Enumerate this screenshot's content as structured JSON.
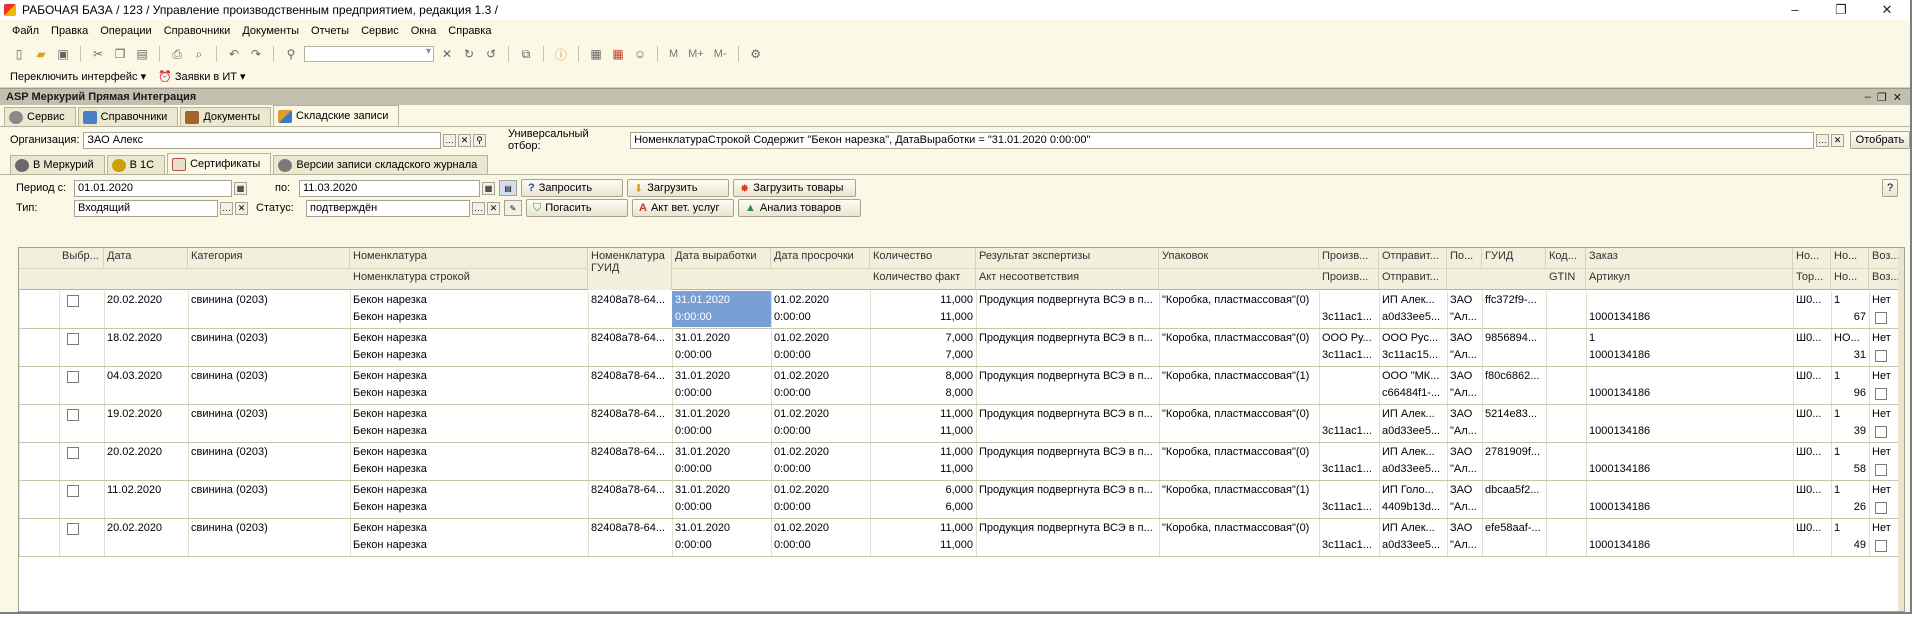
{
  "window": {
    "title": "РАБОЧАЯ БАЗА / 123 / Управление производственным предприятием, редакция 1.3 /",
    "controls": [
      "–",
      "❐",
      "✕"
    ]
  },
  "menu": [
    "Файл",
    "Правка",
    "Операции",
    "Справочники",
    "Документы",
    "Отчеты",
    "Сервис",
    "Окна",
    "Справка"
  ],
  "toolbar2": {
    "switch_interface": "Переключить интерфейс",
    "requests_it": "Заявки в ИТ",
    "m": "M",
    "mplus": "M+",
    "mminus": "M-"
  },
  "subwindow": {
    "title": "ASP Меркурий Прямая Интеграция",
    "tabs": [
      "Сервис",
      "Справочники",
      "Документы",
      "Складские записи"
    ]
  },
  "org": {
    "label": "Организация:",
    "value": "ЗАО  Алекс",
    "universal_filter_label": "Универсальный отбор:",
    "universal_filter_value": "НоменклатураСтрокой Содержит \"Бекон нарезка\", ДатаВыработки = \"31.01.2020 0:00:00\"",
    "select_button": "Отобрать"
  },
  "inner_tabs": [
    "В Меркурий",
    "В 1С",
    "Сертификаты",
    "Версии записи складского журнала"
  ],
  "filters": {
    "period_from_label": "Период с:",
    "period_from": "01.01.2020",
    "period_to_label": "по:",
    "period_to": "11.03.2020",
    "type_label": "Тип:",
    "type_value": "Входящий",
    "status_label": "Статус:",
    "status_value": "подтверждён",
    "btn_request": "Запросить",
    "btn_load": "Загрузить",
    "btn_load_goods": "Загрузить товары",
    "btn_repay": "Погасить",
    "btn_act": "Акт вет. услуг",
    "btn_analysis": "Анализ товаров",
    "help": "?"
  },
  "table": {
    "headers_top": [
      "Выбр...",
      "Дата",
      "Категория",
      "Номенклатура",
      "Номенклатура ГУИД",
      "Дата выработки",
      "Дата просрочки",
      "Количество",
      "Результат экспертизы",
      "Упаковок",
      "Произв...",
      "Отправит...",
      "По...",
      "ГУИД",
      "Код...",
      "Заказ",
      "Но...",
      "Но...",
      "Воз..."
    ],
    "headers_bottom": [
      "Номенклатура строкой",
      "Количество факт",
      "Акт несоответствия",
      "Произв...",
      "Отправит...",
      "GTIN",
      "Артикул",
      "Тор...",
      "Но...",
      "Воз..."
    ],
    "rows": [
      {
        "date": "20.02.2020",
        "category": "свинина (0203)",
        "nom": "Бекон нарезка",
        "nom_str": "Бекон нарезка",
        "guid_nom": "82408a78-64...",
        "prod_date": "31.01.2020",
        "prod_time": "0:00:00",
        "exp_date": "01.02.2020",
        "exp_time": "0:00:00",
        "qty": "11,000",
        "qty_fact": "11,000",
        "result": "Продукция подвергнута ВСЭ в п...",
        "pack": "\"Коробка, пластмассовая\"(0)",
        "prod2": "3c11ac1...",
        "sender": "ИП Алек...",
        "sender2": "a0d33ee5...",
        "po": "ЗАО",
        "po2": "\"Ал...",
        "guid": "ffc372f9-...",
        "order": "",
        "article": "1000134186",
        "n1": "Ш0...",
        "n2": "1",
        "n3": "67",
        "voz": "Нет",
        "selected": true
      },
      {
        "date": "18.02.2020",
        "category": "свинина (0203)",
        "nom": "Бекон нарезка",
        "nom_str": "Бекон нарезка",
        "guid_nom": "82408a78-64...",
        "prod_date": "31.01.2020",
        "prod_time": "0:00:00",
        "exp_date": "01.02.2020",
        "exp_time": "0:00:00",
        "qty": "7,000",
        "qty_fact": "7,000",
        "result": "Продукция подвергнута ВСЭ в п...",
        "pack": "\"Коробка, пластмассовая\"(0)",
        "prod1": "ООО Ру...",
        "prod2": "3c11ac1...",
        "sender": "ООО Рус...",
        "sender2": "3c11ac15...",
        "po": "ЗАО",
        "po2": "\"Ал...",
        "guid": "9856894...",
        "order": "1",
        "article": "1000134186",
        "n1": "Ш0...",
        "n2": "НО...",
        "n3": "31",
        "voz": "Нет"
      },
      {
        "date": "04.03.2020",
        "category": "свинина (0203)",
        "nom": "Бекон нарезка",
        "nom_str": "Бекон нарезка",
        "guid_nom": "82408a78-64...",
        "prod_date": "31.01.2020",
        "prod_time": "0:00:00",
        "exp_date": "01.02.2020",
        "exp_time": "0:00:00",
        "qty": "8,000",
        "qty_fact": "8,000",
        "result": "Продукция подвергнута ВСЭ в п...",
        "pack": "\"Коробка, пластмассовая\"(1)",
        "sender": "ООО \"МК...",
        "sender2": "c66484f1-...",
        "po": "ЗАО",
        "po2": "\"Ал...",
        "guid": "f80c6862...",
        "order": "",
        "article": "1000134186",
        "n1": "Ш0...",
        "n2": "1",
        "n3": "96",
        "voz": "Нет"
      },
      {
        "date": "19.02.2020",
        "category": "свинина (0203)",
        "nom": "Бекон нарезка",
        "nom_str": "Бекон нарезка",
        "guid_nom": "82408a78-64...",
        "prod_date": "31.01.2020",
        "prod_time": "0:00:00",
        "exp_date": "01.02.2020",
        "exp_time": "0:00:00",
        "qty": "11,000",
        "qty_fact": "11,000",
        "result": "Продукция подвергнута ВСЭ в п...",
        "pack": "\"Коробка, пластмассовая\"(0)",
        "prod2": "3c11ac1...",
        "sender": "ИП Алек...",
        "sender2": "a0d33ee5...",
        "po": "ЗАО",
        "po2": "\"Ал...",
        "guid": "5214e83...",
        "order": "",
        "article": "1000134186",
        "n1": "Ш0...",
        "n2": "1",
        "n3": "39",
        "voz": "Нет"
      },
      {
        "date": "20.02.2020",
        "category": "свинина (0203)",
        "nom": "Бекон нарезка",
        "nom_str": "Бекон нарезка",
        "guid_nom": "82408a78-64...",
        "prod_date": "31.01.2020",
        "prod_time": "0:00:00",
        "exp_date": "01.02.2020",
        "exp_time": "0:00:00",
        "qty": "11,000",
        "qty_fact": "11,000",
        "result": "Продукция подвергнута ВСЭ в п...",
        "pack": "\"Коробка, пластмассовая\"(0)",
        "prod2": "3c11ac1...",
        "sender": "ИП Алек...",
        "sender2": "a0d33ee5...",
        "po": "ЗАО",
        "po2": "\"Ал...",
        "guid": "2781909f...",
        "order": "",
        "article": "1000134186",
        "n1": "Ш0...",
        "n2": "1",
        "n3": "58",
        "voz": "Нет"
      },
      {
        "date": "11.02.2020",
        "category": "свинина (0203)",
        "nom": "Бекон нарезка",
        "nom_str": "Бекон нарезка",
        "guid_nom": "82408a78-64...",
        "prod_date": "31.01.2020",
        "prod_time": "0:00:00",
        "exp_date": "01.02.2020",
        "exp_time": "0:00:00",
        "qty": "6,000",
        "qty_fact": "6,000",
        "result": "Продукция подвергнута ВСЭ в п...",
        "pack": "\"Коробка, пластмассовая\"(1)",
        "prod2": "3c11ac1...",
        "sender": "ИП Голо...",
        "sender2": "4409b13d...",
        "po": "ЗАО",
        "po2": "\"Ал...",
        "guid": "dbcaa5f2...",
        "order": "",
        "article": "1000134186",
        "n1": "Ш0...",
        "n2": "1",
        "n3": "26",
        "voz": "Нет"
      },
      {
        "date": "20.02.2020",
        "category": "свинина (0203)",
        "nom": "Бекон нарезка",
        "nom_str": "Бекон нарезка",
        "guid_nom": "82408a78-64...",
        "prod_date": "31.01.2020",
        "prod_time": "0:00:00",
        "exp_date": "01.02.2020",
        "exp_time": "0:00:00",
        "qty": "11,000",
        "qty_fact": "11,000",
        "result": "Продукция подвергнута ВСЭ в п...",
        "pack": "\"Коробка, пластмассовая\"(0)",
        "prod2": "3c11ac1...",
        "sender": "ИП Алек...",
        "sender2": "a0d33ee5...",
        "po": "ЗАО",
        "po2": "\"Ал...",
        "guid": "efe58aaf-...",
        "order": "",
        "article": "1000134186",
        "n1": "Ш0...",
        "n2": "1",
        "n3": "49",
        "voz": "Нет"
      }
    ]
  }
}
